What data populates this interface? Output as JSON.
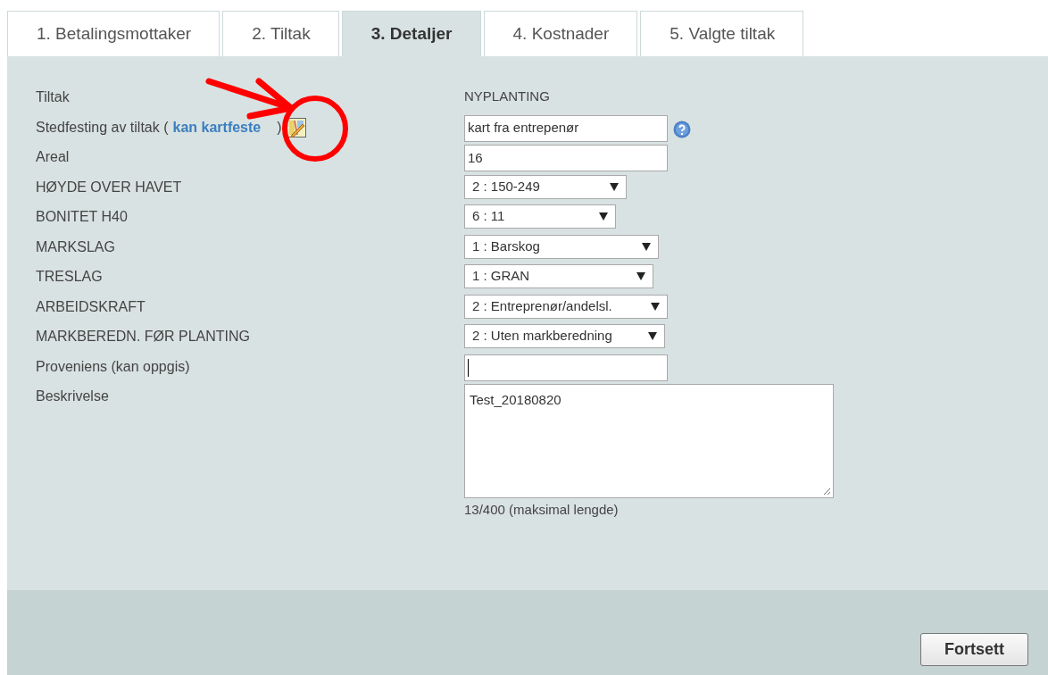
{
  "tabs": [
    {
      "label": "1. Betalingsmottaker",
      "selected": false
    },
    {
      "label": "2. Tiltak",
      "selected": false
    },
    {
      "label": "3. Detaljer",
      "selected": true
    },
    {
      "label": "4. Kostnader",
      "selected": false
    },
    {
      "label": "5. Valgte tiltak",
      "selected": false
    }
  ],
  "form": [
    {
      "kind": "static",
      "label": "Tiltak",
      "value": "NYPLANTING"
    },
    {
      "kind": "text",
      "label": "Stedfesting av tiltak (",
      "link": "kan kartfeste",
      "label_end": ")",
      "map_icon": true,
      "value": "kart fra entrepenør",
      "help_icon": true
    },
    {
      "kind": "text",
      "label": "Areal",
      "value": "16"
    },
    {
      "kind": "select",
      "label": "HØYDE OVER HAVET",
      "value": "2 : 150-249"
    },
    {
      "kind": "select",
      "label": "BONITET H40",
      "value": "6 : 11"
    },
    {
      "kind": "select",
      "label": "MARKSLAG",
      "value": "1 : Barskog"
    },
    {
      "kind": "select",
      "label": "TRESLAG",
      "value": "1 : GRAN"
    },
    {
      "kind": "select",
      "label": "ARBEIDSKRAFT",
      "value": "2 : Entreprenør/andelsl."
    },
    {
      "kind": "select",
      "label": "MARKBEREDN. FØR PLANTING",
      "value": "2 : Uten markberedning"
    },
    {
      "kind": "text",
      "label": "Proveniens (kan oppgis)",
      "focused": true
    },
    {
      "kind": "textarea",
      "label": "Beskrivelse",
      "value": "Test_20180820",
      "counter": "13/400 (maksimal lengde)"
    }
  ],
  "footer": {
    "button": "Fortsett"
  }
}
